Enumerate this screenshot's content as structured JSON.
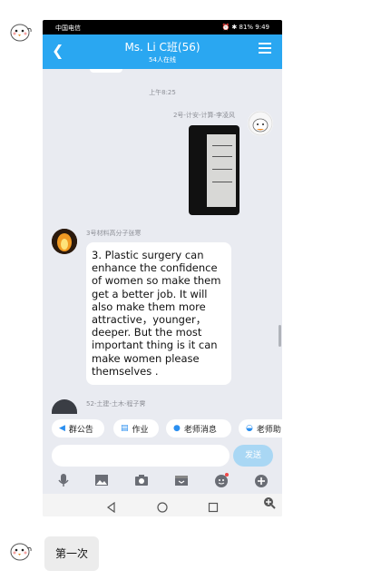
{
  "phone": {
    "status": {
      "carrier": "中国电信",
      "right": "⏰ ✱ 81% 9:49"
    },
    "header": {
      "title": "Ms. Li C班(56)",
      "online": "54人在线"
    },
    "time_divider": "上午8:25",
    "sender1": {
      "name": "2号-计安-计算-李凌风"
    },
    "sender2": {
      "name": "3号材料高分子张寒"
    },
    "message_text": "3. Plastic surgery can enhance the confidence of women so make them get a better job. It will also make them more attractive，younger，deeper. But the most important thing is it can make women  please themselves .",
    "sender3": {
      "name": "52-土建-土木-程子霁"
    },
    "chips": [
      {
        "icon": "megaphone-icon",
        "label": "群公告"
      },
      {
        "icon": "document-icon",
        "label": "作业"
      },
      {
        "icon": "chat-icon",
        "label": "老师消息"
      },
      {
        "icon": "users-icon",
        "label": "老师助"
      }
    ],
    "send_label": "发送",
    "input_placeholder": ""
  },
  "chat": {
    "reply_text": "第一次"
  },
  "colors": {
    "header": "#2aa7f1",
    "chat_bg": "#e9ebf1",
    "send": "#a9d7f4"
  }
}
